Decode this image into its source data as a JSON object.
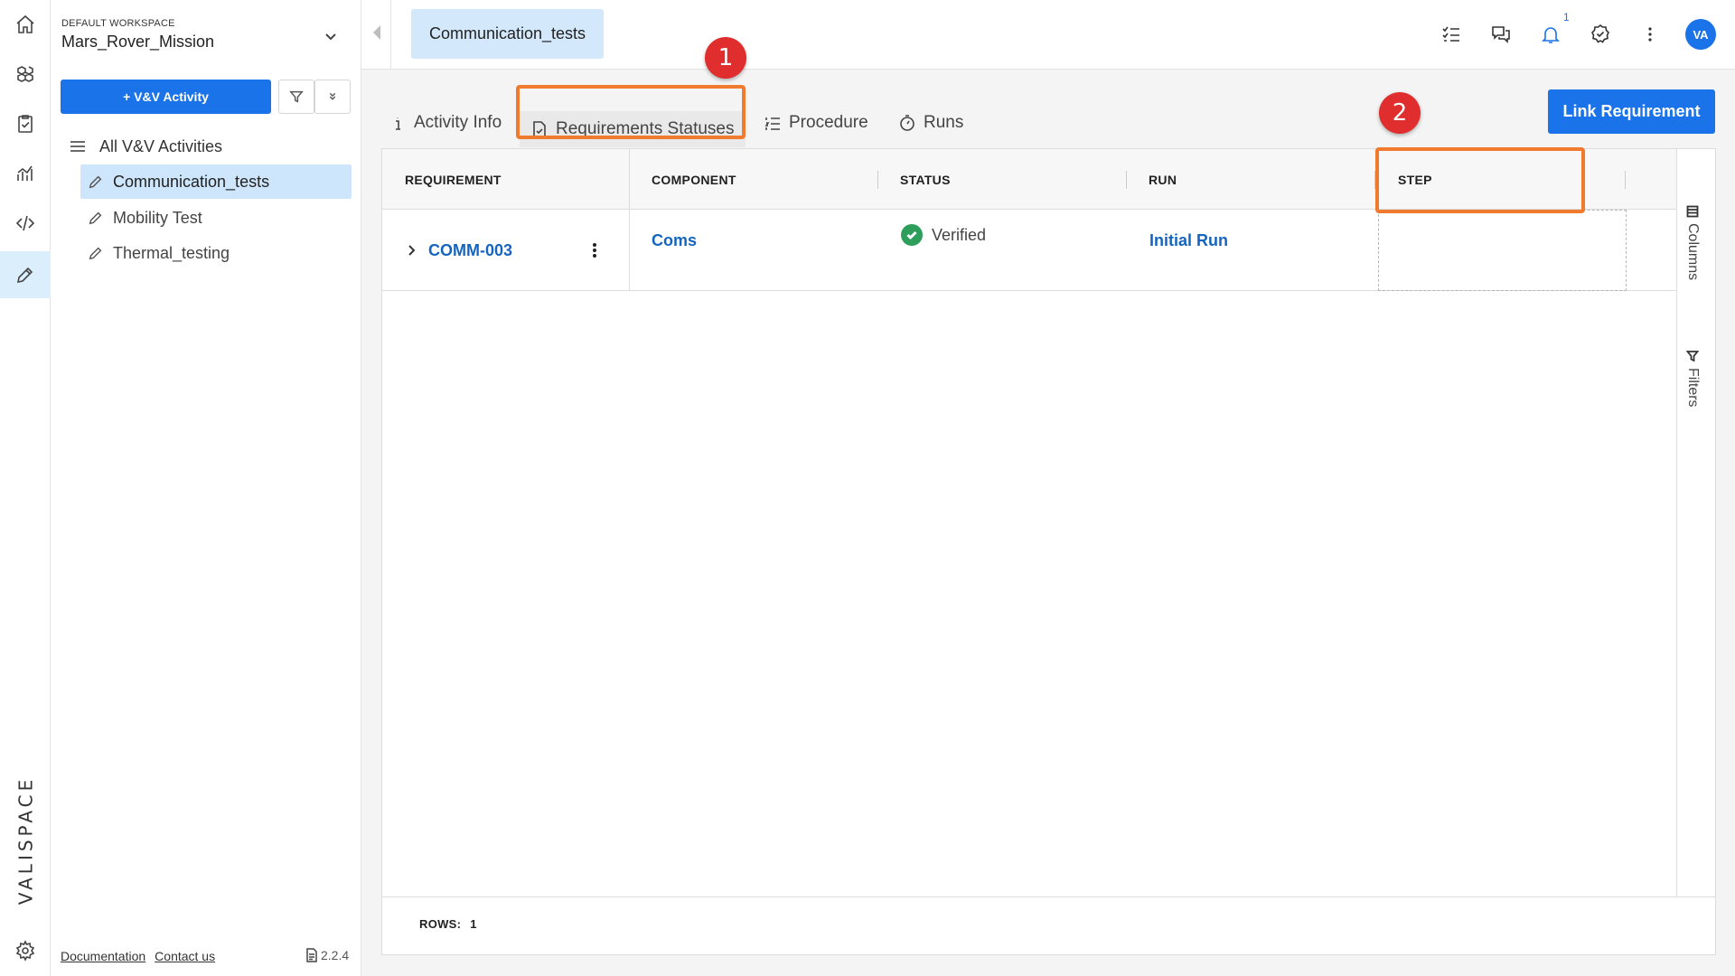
{
  "rail": {
    "icons": [
      "home-icon",
      "modules-icon",
      "clipboard-check-icon",
      "analytics-icon",
      "code-icon",
      "pen-icon",
      "gear-icon"
    ],
    "brand": "VALISPACE"
  },
  "sidebar": {
    "workspace_label": "DEFAULT WORKSPACE",
    "workspace_name": "Mars_Rover_Mission",
    "add_button": "+ V&V Activity",
    "tree_root": "All V&V Activities",
    "items": [
      {
        "label": "Communication_tests",
        "active": true
      },
      {
        "label": "Mobility Test",
        "active": false
      },
      {
        "label": "Thermal_testing",
        "active": false
      }
    ],
    "footer": {
      "documentation": "Documentation",
      "contact": "Contact us",
      "version": "2.2.4"
    }
  },
  "topbar": {
    "active_tab": "Communication_tests",
    "notification_count": "1",
    "avatar_initials": "VA"
  },
  "tabs": {
    "activity_info": "Activity Info",
    "requirements_statuses": "Requirements Statuses",
    "procedure": "Procedure",
    "runs": "Runs",
    "selected": "Requirements Statuses"
  },
  "link_requirement_button": "Link Requirement",
  "annotations": {
    "badge_1": "1",
    "badge_2": "2",
    "highlight_color": "#f07a2e",
    "badge_color": "#e02d2d"
  },
  "grid": {
    "headers": {
      "requirement": "REQUIREMENT",
      "component": "COMPONENT",
      "status": "STATUS",
      "run": "RUN",
      "step": "STEP"
    },
    "rows": [
      {
        "requirement": "COMM-003",
        "component": "Coms",
        "status": "Verified",
        "run": "Initial Run",
        "step": ""
      }
    ],
    "side_tabs": {
      "columns": "Columns",
      "filters": "Filters"
    },
    "footer_label": "ROWS:",
    "row_count": "1"
  },
  "colors": {
    "accent": "#1a73e8",
    "selected_bg": "#cde6fb",
    "verified": "#2e9e5b"
  }
}
